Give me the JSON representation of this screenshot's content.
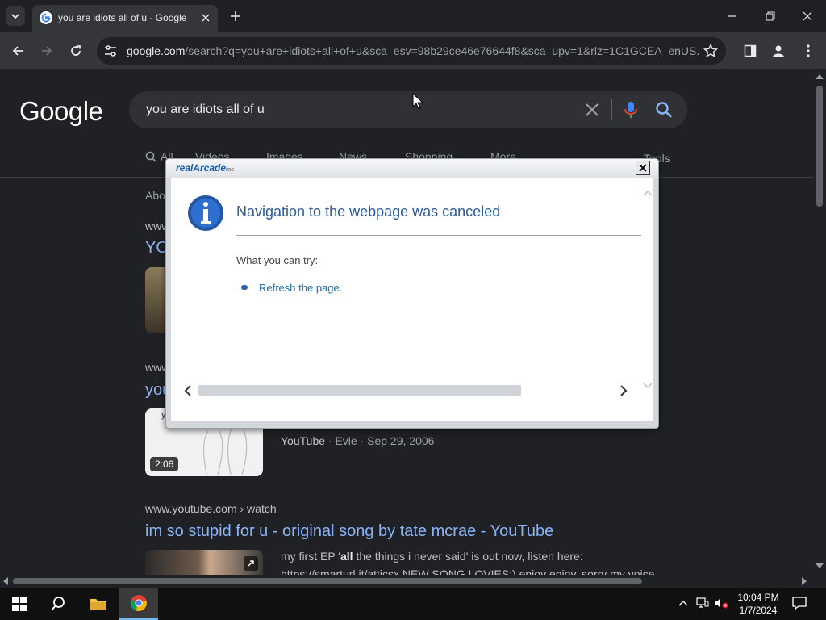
{
  "browser": {
    "tab_title": "you are idiots all of u - Google",
    "url_host": "google.com",
    "url_path": "/search?q=you+are+idiots+all+of+u&sca_esv=98b29ce46e76644f8&sca_upv=1&rlz=1C1GCEA_enUS..."
  },
  "search": {
    "logo": "Google",
    "query": "you are idiots all of u",
    "tabs": [
      "All",
      "Videos",
      "Images",
      "News",
      "Shopping",
      "More"
    ],
    "tools": "Tools",
    "about": "Abo"
  },
  "results": [
    {
      "site": "www",
      "title": "YO"
    },
    {
      "site": "www",
      "title": "you",
      "thumb_text": "y",
      "duration": "2:06",
      "source": "YouTube",
      "meta": " · Evie · Sep 29, 2006"
    },
    {
      "site": "www.youtube.com › watch",
      "title": "im so stupid for u - original song by tate mcrae - YouTube",
      "snippet_pre": "my first EP '",
      "snippet_bold": "all",
      "snippet_post": " the things i never said' is out now, listen here:",
      "snippet2": "https://smarturl.it/atticsx NEW SONG LOVIES:) enjoy enjoy, sorry my voice"
    }
  ],
  "dialog": {
    "brand": "realArcade",
    "brand_suffix": "inc",
    "heading": "Navigation to the webpage was canceled",
    "try_label": "What you can try:",
    "link": "Refresh the page."
  },
  "taskbar": {
    "time": "10:04 PM",
    "date": "1/7/2024"
  },
  "colors": {
    "accent_link": "#8ab4f8",
    "dialog_heading": "#2c5a9b"
  }
}
